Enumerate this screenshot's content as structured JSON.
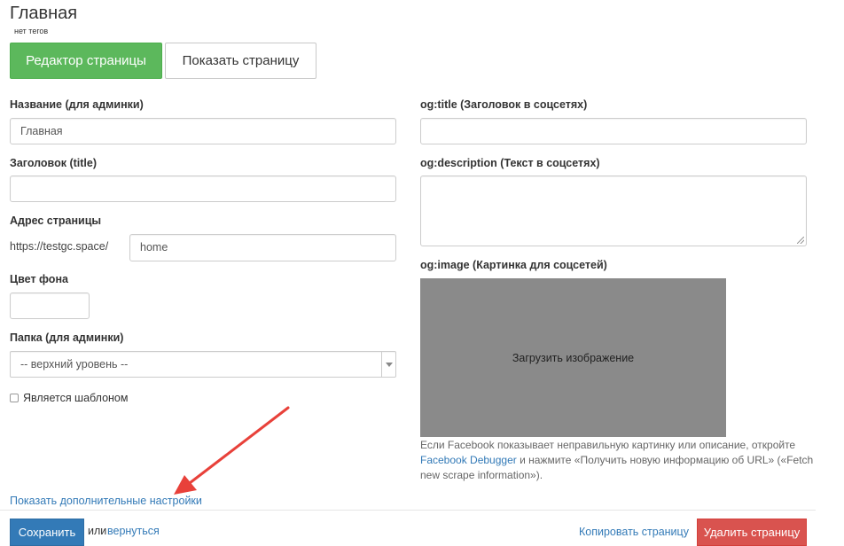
{
  "page": {
    "title": "Главная",
    "tags": "нет тегов"
  },
  "toolbar": {
    "editor_label": "Редактор страницы",
    "show_label": "Показать страницу"
  },
  "form": {
    "name_label": "Название (для админки)",
    "name_value": "Главная",
    "title_label": "Заголовок (title)",
    "title_value": "",
    "address_label": "Адрес страницы",
    "address_prefix": "https://testgc.space/",
    "address_value": "home",
    "bgcolor_label": "Цвет фона",
    "bgcolor_value": "",
    "folder_label": "Папка (для админки)",
    "folder_value": "-- верхний уровень --",
    "template_label": "Является шаблоном",
    "template_checked": false,
    "og_title_label": "og:title (Заголовок в соцсетях)",
    "og_title_value": "",
    "og_description_label": "og:description (Текст в соцсетях)",
    "og_description_value": "",
    "og_image_label": "og:image (Картинка для соцсетей)",
    "upload_label": "Загрузить изображение",
    "note_before": "Если Facebook показывает неправильную картинку или описание, откройте",
    "note_link": "Facebook Debugger",
    "note_after": " и нажмите «Получить новую информацию об URL» («Fetch new scrape information»).",
    "more_settings": "Показать дополнительные настройки"
  },
  "footer": {
    "save_label": "Сохранить",
    "or_text": "или",
    "back_link": "вернуться",
    "copy_link": "Копировать страницу",
    "delete_label": "Удалить страницу"
  },
  "colors": {
    "primary": "#337ab7",
    "success": "#5cb85c",
    "danger": "#d9534f",
    "annotation_arrow": "#e8413a",
    "upload_bg": "#8a8a8a"
  }
}
